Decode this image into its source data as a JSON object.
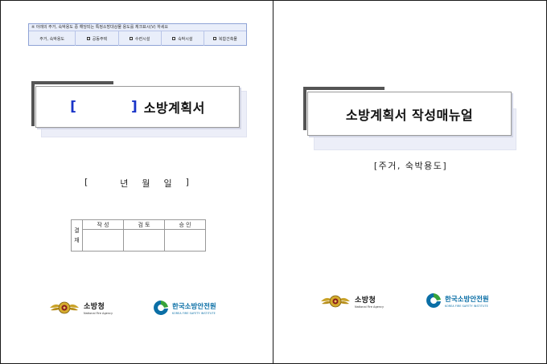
{
  "left_page": {
    "checkbox_note": "※ 아래의 주거, 숙박용도 중 해당되는 특정소방대상물 용도를 체크표시(V) 하세요",
    "category_label": "주거, 숙박용도",
    "options": [
      "공동주택",
      "수련시설",
      "숙박시설",
      "복합건축물"
    ],
    "title_bracket_open": "[",
    "title_bracket_close": "]",
    "title": "소방계획서",
    "date": {
      "open": "[",
      "year": "년",
      "month": "월",
      "day": "일",
      "close": "]"
    },
    "approval": {
      "side_label_1": "결",
      "side_label_2": "재",
      "headers": [
        "작 성",
        "검 토",
        "승 인"
      ]
    }
  },
  "right_page": {
    "title": "소방계획서 작성매뉴얼",
    "subtitle": "[주거, 숙박용도]"
  },
  "logos": {
    "agency_ko": "소방청",
    "agency_en": "National Fire Agency",
    "institute_ko": "한국소방안전원",
    "institute_en": "KOREA FIRE SAFETY INSTITUTE"
  },
  "colors": {
    "accent_blue": "#1a35c8",
    "institute_blue": "#0b6fa6",
    "institute_green": "#37a33b",
    "emblem_gold": "#c9a227"
  }
}
